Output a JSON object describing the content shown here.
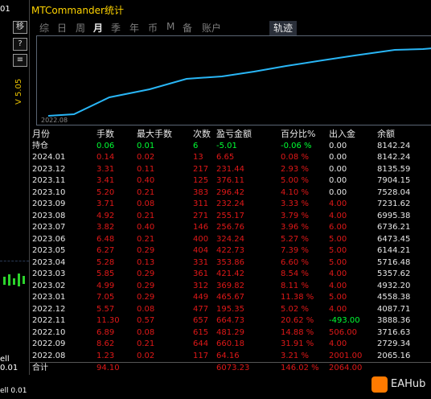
{
  "window": {
    "title": "MTCommander统计"
  },
  "tabs": [
    {
      "label": "综"
    },
    {
      "label": "日"
    },
    {
      "label": "周"
    },
    {
      "label": "月",
      "active": true
    },
    {
      "label": "季"
    },
    {
      "label": "年"
    },
    {
      "label": "币"
    },
    {
      "label": "M"
    },
    {
      "label": "备"
    },
    {
      "label": "账户"
    }
  ],
  "track_tab": {
    "label": "轨迹"
  },
  "chart": {
    "start_date_label": "2022.08",
    "line_color": "#29b6f6"
  },
  "left_strip": {
    "buttons": [
      "移",
      "?",
      "≡"
    ],
    "vlabel": "V 5.05",
    "price_top": "01",
    "price_bottom": "ell 0.01",
    "price_bottom2": "ell 0.01"
  },
  "table": {
    "headers": [
      "月份",
      "手数",
      "最大手数",
      "次数",
      "盈亏金额",
      "百分比%",
      "出入金",
      "余额"
    ],
    "holding": [
      "持仓",
      "0.06",
      "0.01",
      "6",
      "-5.01",
      "-0.06 %",
      "0.00",
      "8142.24"
    ],
    "rows": [
      [
        "2024.01",
        "0.14",
        "0.02",
        "13",
        "6.65",
        "0.08 %",
        "0.00",
        "8142.24"
      ],
      [
        "2023.12",
        "3.31",
        "0.11",
        "217",
        "231.44",
        "2.93 %",
        "0.00",
        "8135.59"
      ],
      [
        "2023.11",
        "3.41",
        "0.40",
        "125",
        "376.11",
        "5.00 %",
        "0.00",
        "7904.15"
      ],
      [
        "2023.10",
        "5.20",
        "0.21",
        "383",
        "296.42",
        "4.10 %",
        "0.00",
        "7528.04"
      ],
      [
        "2023.09",
        "3.71",
        "0.08",
        "311",
        "232.24",
        "3.33 %",
        "4.00",
        "7231.62"
      ],
      [
        "2023.08",
        "4.92",
        "0.21",
        "271",
        "255.17",
        "3.79 %",
        "4.00",
        "6995.38"
      ],
      [
        "2023.07",
        "3.82",
        "0.40",
        "146",
        "256.76",
        "3.96 %",
        "6.00",
        "6736.21"
      ],
      [
        "2023.06",
        "6.48",
        "0.21",
        "400",
        "324.24",
        "5.27 %",
        "5.00",
        "6473.45"
      ],
      [
        "2023.05",
        "6.27",
        "0.29",
        "404",
        "422.73",
        "7.39 %",
        "5.00",
        "6144.21"
      ],
      [
        "2023.04",
        "5.28",
        "0.13",
        "331",
        "353.86",
        "6.60 %",
        "5.00",
        "5716.48"
      ],
      [
        "2023.03",
        "5.85",
        "0.29",
        "361",
        "421.42",
        "8.54 %",
        "4.00",
        "5357.62"
      ],
      [
        "2023.02",
        "4.99",
        "0.29",
        "312",
        "369.82",
        "8.11 %",
        "4.00",
        "4932.20"
      ],
      [
        "2023.01",
        "7.05",
        "0.29",
        "449",
        "465.67",
        "11.38 %",
        "5.00",
        "4558.38"
      ],
      [
        "2022.12",
        "5.57",
        "0.08",
        "477",
        "195.35",
        "5.02 %",
        "4.00",
        "4087.71"
      ],
      [
        "2022.11",
        "11.30",
        "0.57",
        "657",
        "664.73",
        "20.62 %",
        "-493.00",
        "3888.36"
      ],
      [
        "2022.10",
        "6.89",
        "0.08",
        "615",
        "481.29",
        "14.88 %",
        "506.00",
        "3716.63"
      ],
      [
        "2022.09",
        "8.62",
        "0.21",
        "644",
        "660.18",
        "31.91 %",
        "4.00",
        "2729.34"
      ],
      [
        "2022.08",
        "1.23",
        "0.02",
        "117",
        "64.16",
        "3.21 %",
        "2001.00",
        "2065.16"
      ]
    ],
    "total": [
      "合计",
      "94.10",
      "",
      "",
      "6073.23",
      "146.02 %",
      "2064.00",
      ""
    ]
  },
  "brand": {
    "logo_text": "EAHub"
  },
  "colors": {
    "title": "#ffd400",
    "loss_red": "#e01818",
    "positive_green": "#00ff33"
  }
}
